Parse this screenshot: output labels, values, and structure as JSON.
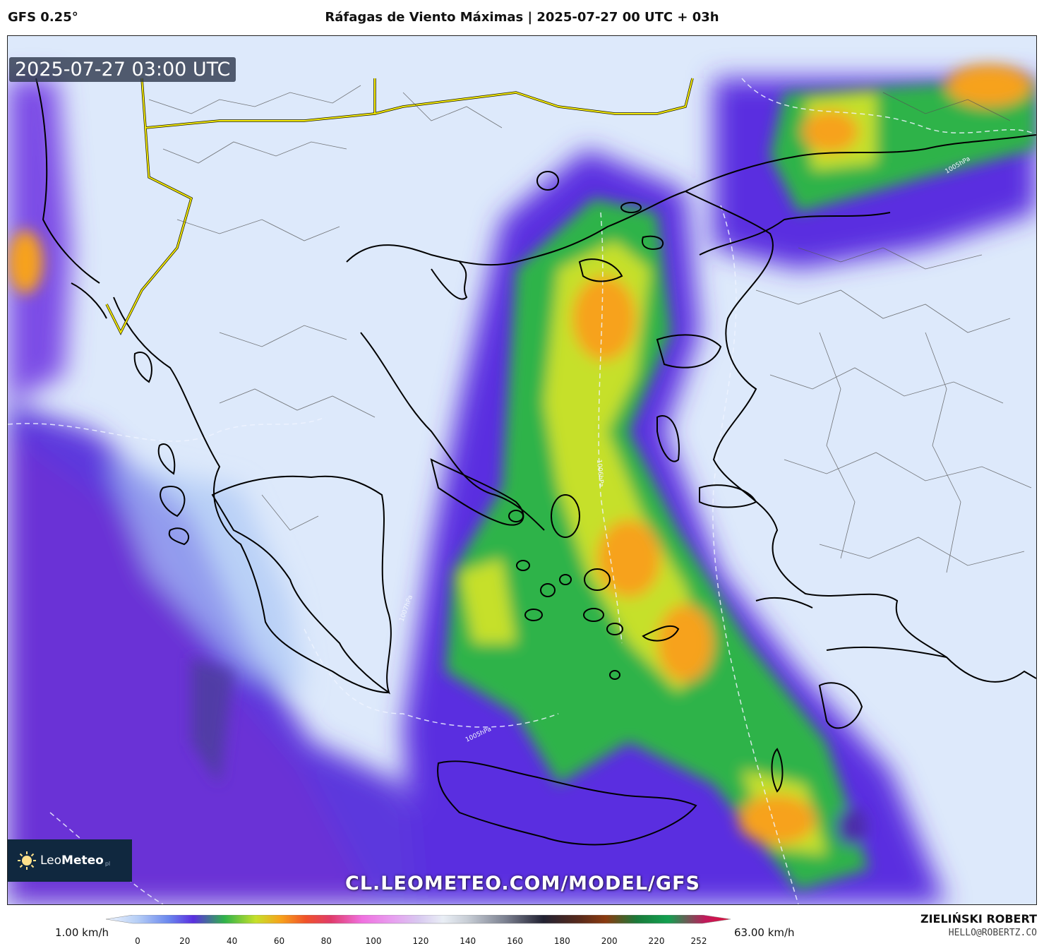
{
  "header": {
    "model": "GFS 0.25°",
    "title": "Ráfagas de Viento Máximas | 2025-07-27 00 UTC + 03h"
  },
  "map": {
    "timestamp": "2025-07-27 03:00 UTC",
    "watermark": "CL.LEOMETEO.COM/MODEL/GFS",
    "logo": {
      "brand_light": "Leo",
      "brand_bold": "Meteo",
      "suffix": "pl"
    },
    "isobars": [
      "1007hPa",
      "1005hPa",
      "1006hPa",
      "1005hPa",
      "1007hPa"
    ],
    "colors": {
      "calm": "#e2edfc",
      "light": "#c3d9f8",
      "moderate": "#7f9ff2",
      "strong": "#5a2fe0",
      "very_strong": "#2fb34a",
      "high": "#c6e02a",
      "peak": "#f7a21b",
      "border_national": "#f2e700",
      "coastline": "#000000",
      "regions": "#555555"
    }
  },
  "legend": {
    "min_label": "1.00 km/h",
    "max_label": "63.00 km/h",
    "ticks": [
      "0",
      "20",
      "40",
      "60",
      "80",
      "100",
      "120",
      "140",
      "160",
      "180",
      "200",
      "220",
      "252"
    ]
  },
  "footer": {
    "author": "ZIELIŃSKI ROBERT",
    "email": "HELLO@ROBERTZ.CO"
  }
}
